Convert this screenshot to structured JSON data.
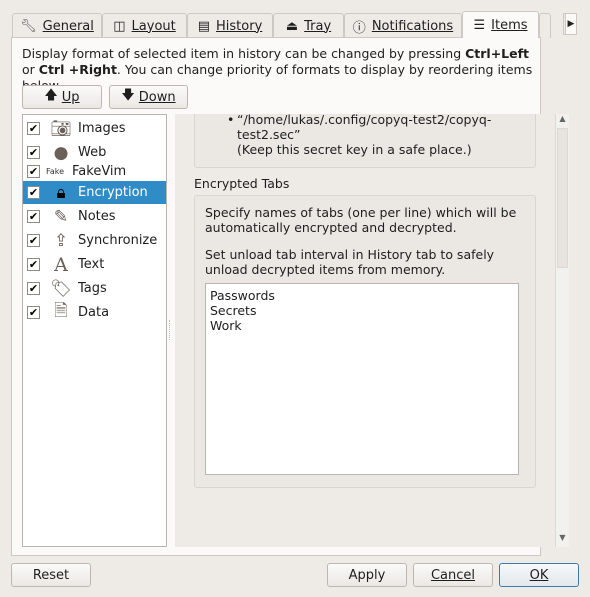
{
  "tabs": [
    {
      "label": "General",
      "icon": "wrench-icon"
    },
    {
      "label": "Layout",
      "icon": "layout-icon"
    },
    {
      "label": "History",
      "icon": "list-icon"
    },
    {
      "label": "Tray",
      "icon": "tray-icon"
    },
    {
      "label": "Notifications",
      "icon": "info-icon"
    },
    {
      "label": "Items",
      "icon": "items-icon",
      "active": true
    }
  ],
  "description": {
    "part1": "Display format of selected item in history can be changed by pressing ",
    "key1": "Ctrl+Left",
    "part2": " or ",
    "key2": "Ctrl +Right",
    "part3": ". You can change priority of formats to display by reordering items below."
  },
  "buttons": {
    "up": "Up",
    "down": "Down",
    "reset": "Reset",
    "apply": "Apply",
    "cancel": "Cancel",
    "ok": "OK"
  },
  "items": [
    {
      "label": "Images",
      "checked": true,
      "icon": "camera-icon"
    },
    {
      "label": "Web",
      "checked": true,
      "icon": "globe-icon"
    },
    {
      "label": "FakeVim",
      "checked": true,
      "icon": "fakevim-icon"
    },
    {
      "label": "Encryption",
      "checked": true,
      "icon": "lock-icon",
      "selected": true
    },
    {
      "label": "Notes",
      "checked": true,
      "icon": "pencil-icon"
    },
    {
      "label": "Synchronize",
      "checked": true,
      "icon": "upload-icon"
    },
    {
      "label": "Text",
      "checked": true,
      "icon": "text-icon"
    },
    {
      "label": "Tags",
      "checked": true,
      "icon": "tag-icon"
    },
    {
      "label": "Data",
      "checked": true,
      "icon": "file-icon"
    }
  ],
  "encryption": {
    "key_path_line1": "“/home/lukas/.config/copyq-test2/copyq-",
    "key_path_line2": "test2.sec”",
    "key_note": "(Keep this secret key in a safe place.)",
    "encrypted_tabs_title": "Encrypted Tabs",
    "info1": "Specify names of tabs (one per line) which will be automatically encrypted and decrypted.",
    "info2": "Set unload tab interval in History tab to safely unload decrypted items from memory.",
    "tabs_value": "Passwords\nSecrets\nWork"
  }
}
